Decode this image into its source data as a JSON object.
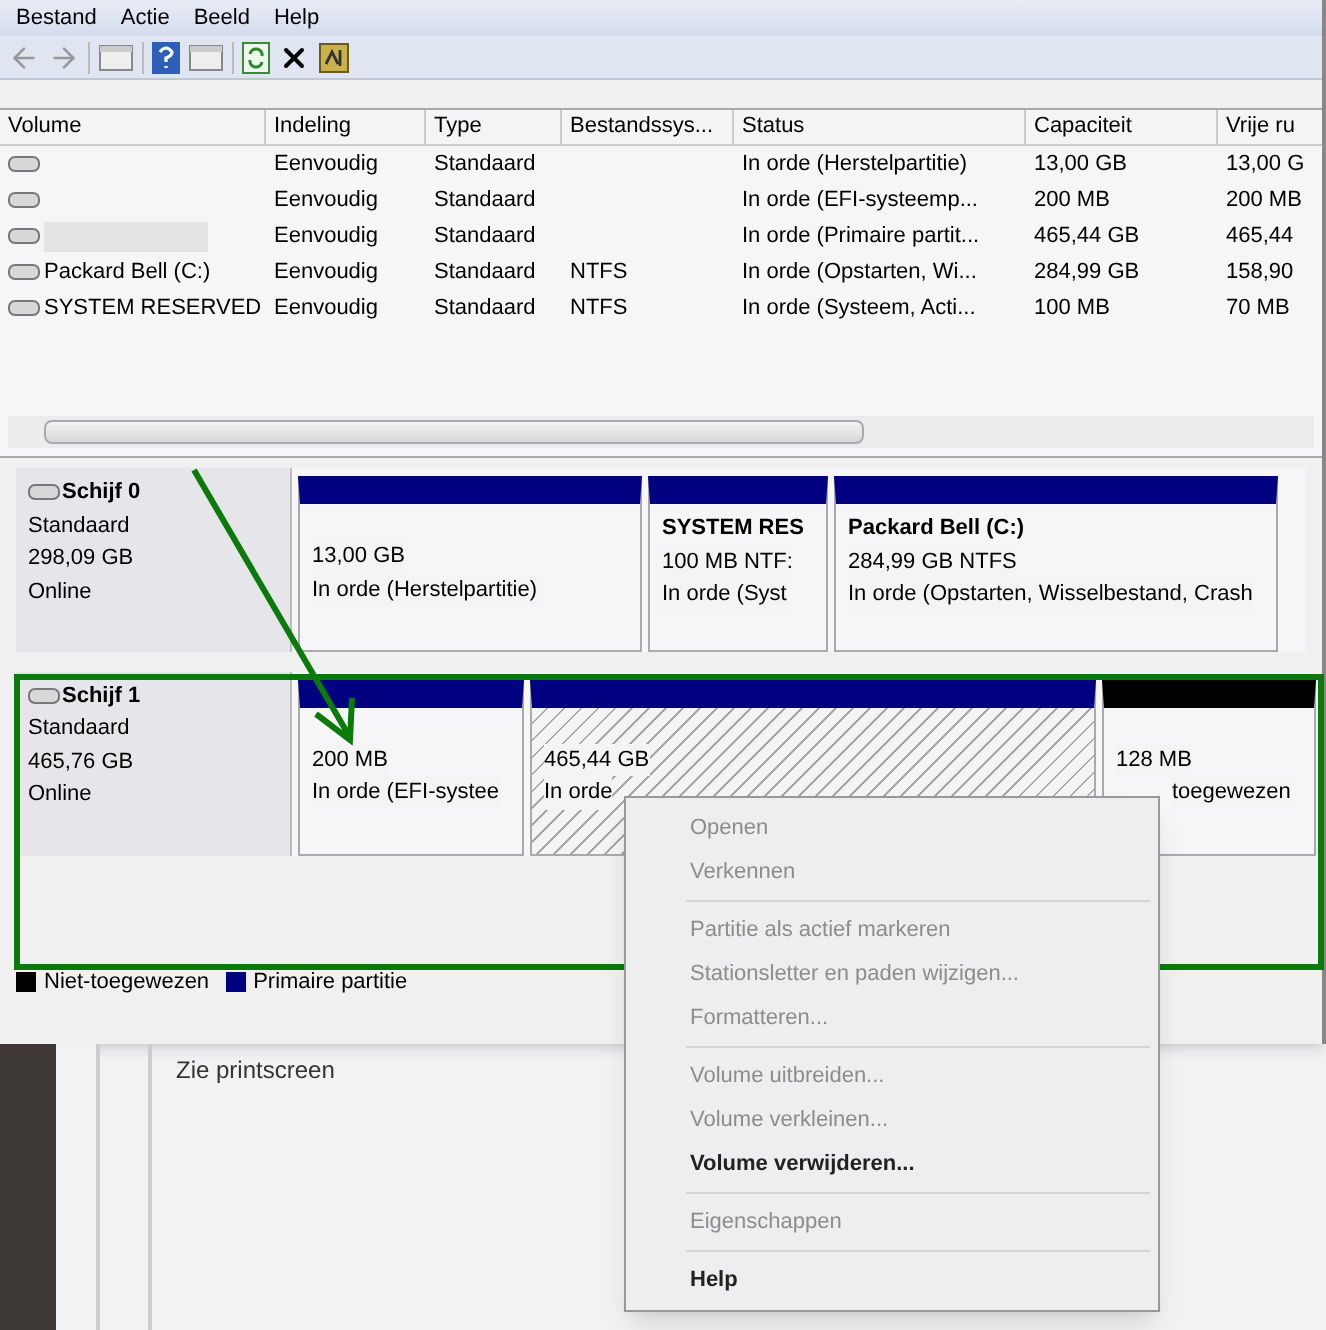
{
  "menu": [
    "Bestand",
    "Actie",
    "Beeld",
    "Help"
  ],
  "table": {
    "columns": [
      "Volume",
      "Indeling",
      "Type",
      "Bestandssys...",
      "Status",
      "Capaciteit",
      "Vrije ru"
    ],
    "rows": [
      {
        "redacted": false,
        "cells": [
          "",
          "Eenvoudig",
          "Standaard",
          "",
          "In orde (Herstelpartitie)",
          "13,00 GB",
          "13,00 G"
        ]
      },
      {
        "redacted": false,
        "cells": [
          "",
          "Eenvoudig",
          "Standaard",
          "",
          "In orde (EFI-systeemp...",
          "200 MB",
          "200 MB"
        ]
      },
      {
        "redacted": true,
        "cells": [
          "",
          "Eenvoudig",
          "Standaard",
          "",
          "In orde (Primaire partit...",
          "465,44 GB",
          "465,44"
        ]
      },
      {
        "redacted": false,
        "cells": [
          "Packard Bell (C:)",
          "Eenvoudig",
          "Standaard",
          "NTFS",
          "In orde (Opstarten, Wi...",
          "284,99 GB",
          "158,90"
        ]
      },
      {
        "redacted": false,
        "cells": [
          "SYSTEM RESERVED",
          "Eenvoudig",
          "Standaard",
          "NTFS",
          "In orde (Systeem, Acti...",
          "100 MB",
          "70 MB"
        ]
      }
    ]
  },
  "disks": [
    {
      "name": "Schijf 0",
      "type": "Standaard",
      "size": "298,09 GB",
      "state": "Online",
      "partitions": [
        {
          "size": "13,00 GB",
          "status": "In orde (Herstelpartitie)",
          "color": "#000080",
          "selected": false
        },
        {
          "title": "SYSTEM RES",
          "size": "100 MB NTF:",
          "status": "In orde (Syst",
          "color": "#000080",
          "selected": false
        },
        {
          "title": "Packard Bell  (C:)",
          "size": "284,99 GB NTFS",
          "status": "In orde (Opstarten, Wisselbestand, Crash",
          "color": "#000080",
          "selected": false
        }
      ]
    },
    {
      "name": "Schijf 1",
      "type": "Standaard",
      "size": "465,76 GB",
      "state": "Online",
      "partitions": [
        {
          "size": "200 MB",
          "status": "In orde (EFI-systee",
          "color": "#000080",
          "selected": false
        },
        {
          "size": "465,44 GB",
          "status": "In orde",
          "color": "#000080",
          "selected": true
        },
        {
          "size": "128 MB",
          "status": "toegewezen",
          "color": "#000000",
          "selected": false
        }
      ]
    }
  ],
  "legend": [
    {
      "label": "Niet-toegewezen",
      "color": "#000000"
    },
    {
      "label": "Primaire partitie",
      "color": "#000080"
    }
  ],
  "background_text": "Zie printscreen",
  "context_menu": [
    {
      "kind": "item",
      "label": "Openen",
      "disabled": true,
      "bold": false
    },
    {
      "kind": "item",
      "label": "Verkennen",
      "disabled": true,
      "bold": false
    },
    {
      "kind": "separator"
    },
    {
      "kind": "item",
      "label": "Partitie als actief markeren",
      "disabled": true,
      "bold": false
    },
    {
      "kind": "item",
      "label": "Stationsletter en paden wijzigen...",
      "disabled": true,
      "bold": false
    },
    {
      "kind": "item",
      "label": "Formatteren...",
      "disabled": true,
      "bold": false
    },
    {
      "kind": "separator"
    },
    {
      "kind": "item",
      "label": "Volume uitbreiden...",
      "disabled": true,
      "bold": false
    },
    {
      "kind": "item",
      "label": "Volume verkleinen...",
      "disabled": true,
      "bold": false
    },
    {
      "kind": "item",
      "label": "Volume verwijderen...",
      "disabled": false,
      "bold": true
    },
    {
      "kind": "separator"
    },
    {
      "kind": "item",
      "label": "Eigenschappen",
      "disabled": true,
      "bold": false
    },
    {
      "kind": "separator"
    },
    {
      "kind": "item",
      "label": "Help",
      "disabled": false,
      "bold": true
    }
  ]
}
